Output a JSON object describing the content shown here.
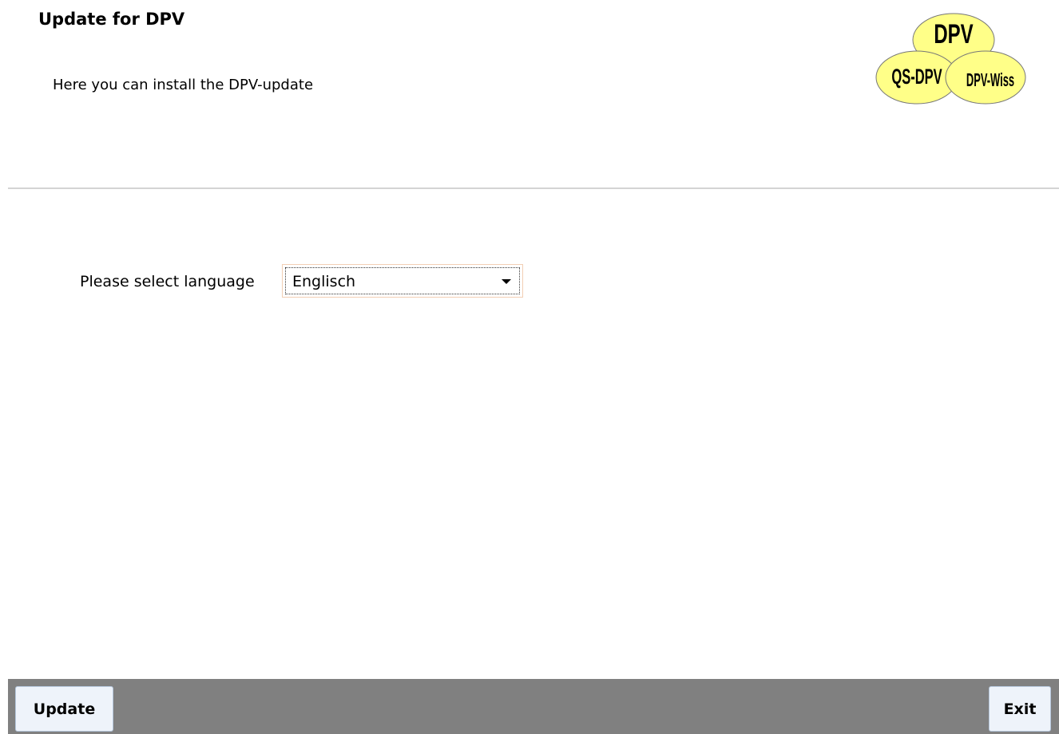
{
  "header": {
    "title": "Update for DPV",
    "subtitle": "Here you can install the DPV-update"
  },
  "logo": {
    "top_text": "DPV",
    "left_text": "QS-DPV",
    "right_text": "DPV-Wiss",
    "fill_color": "#ffff88"
  },
  "language": {
    "label": "Please select language",
    "selected": "Englisch"
  },
  "footer": {
    "update_label": "Update",
    "exit_label": "Exit",
    "bar_color": "#808080"
  }
}
